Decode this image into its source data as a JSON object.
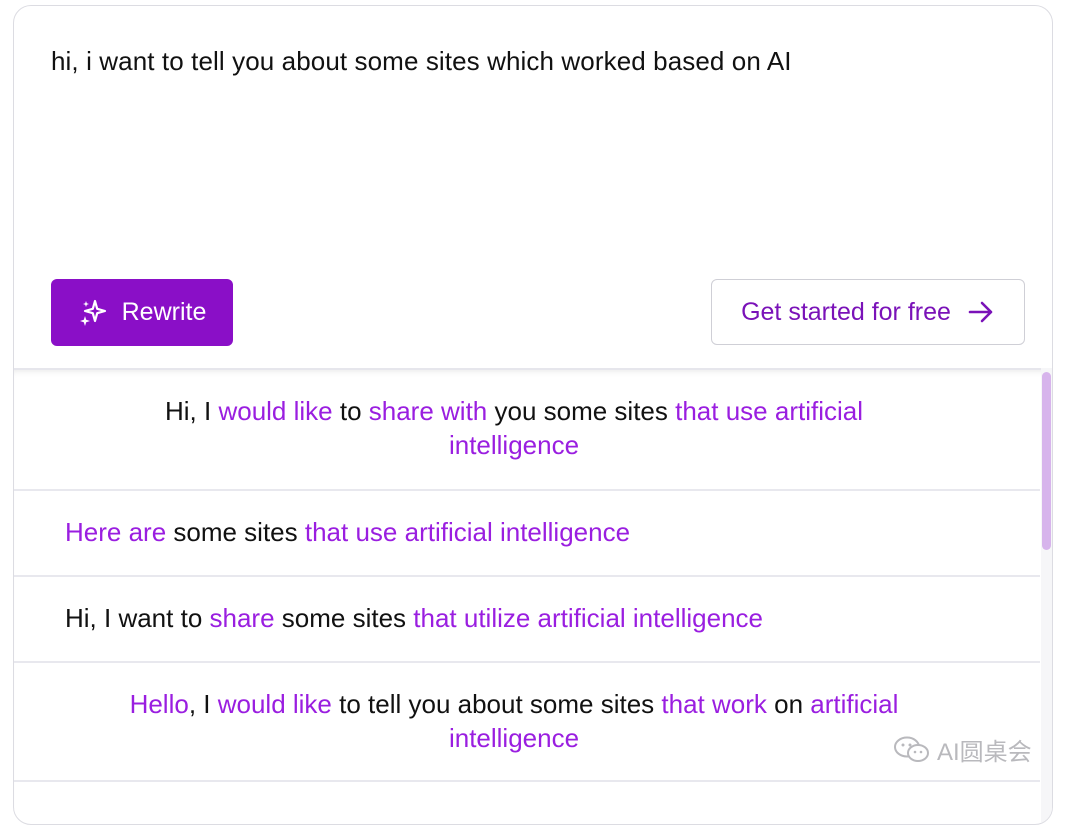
{
  "input": {
    "text": "hi, i want to tell you about some sites which worked based on AI"
  },
  "buttons": {
    "rewrite_label": "Rewrite",
    "rewrite_icon": "sparkles-icon",
    "get_started_label": "Get started for free",
    "get_started_icon": "arrow-right-icon"
  },
  "colors": {
    "accent": "#8a0fc7",
    "highlight": "#9a1ee0",
    "scroll_thumb": "#d7b4ec"
  },
  "suggestions": [
    {
      "align": "center",
      "lines": [
        [
          {
            "t": "Hi, I ",
            "h": false
          },
          {
            "t": "would like",
            "h": true
          },
          {
            "t": " to ",
            "h": false
          },
          {
            "t": "share with",
            "h": true
          },
          {
            "t": " you some sites ",
            "h": false
          },
          {
            "t": "that use artificial",
            "h": true
          }
        ],
        [
          {
            "t": "intelligence",
            "h": true
          }
        ]
      ]
    },
    {
      "align": "left",
      "lines": [
        [
          {
            "t": "Here are",
            "h": true
          },
          {
            "t": " some sites ",
            "h": false
          },
          {
            "t": "that use artificial intelligence",
            "h": true
          }
        ]
      ]
    },
    {
      "align": "left",
      "lines": [
        [
          {
            "t": "Hi, I want to ",
            "h": false
          },
          {
            "t": "share",
            "h": true
          },
          {
            "t": " some sites ",
            "h": false
          },
          {
            "t": "that utilize artificial intelligence",
            "h": true
          }
        ]
      ]
    },
    {
      "align": "center",
      "lines": [
        [
          {
            "t": "Hello",
            "h": true
          },
          {
            "t": ", I ",
            "h": false
          },
          {
            "t": "would like",
            "h": true
          },
          {
            "t": " to tell you about some sites ",
            "h": false
          },
          {
            "t": "that work",
            "h": true
          },
          {
            "t": " on ",
            "h": false
          },
          {
            "t": "artificial",
            "h": true
          }
        ],
        [
          {
            "t": "intelligence",
            "h": true
          }
        ]
      ]
    }
  ],
  "watermark": {
    "text": "AI圆桌会",
    "icon": "wechat-icon"
  }
}
